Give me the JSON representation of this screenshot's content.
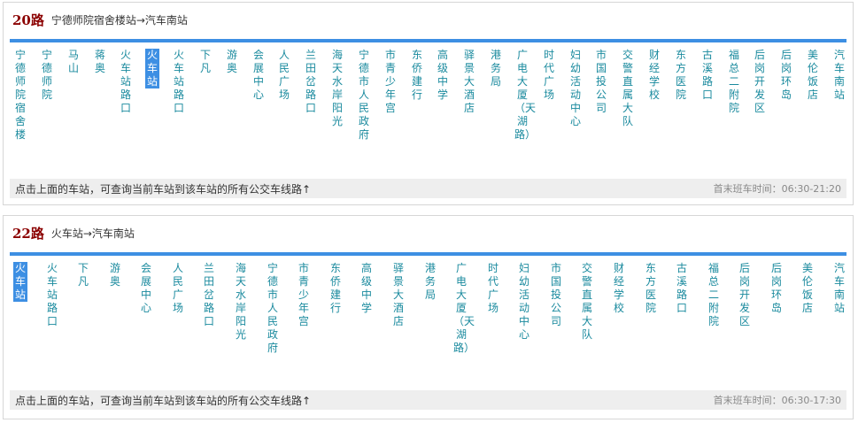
{
  "routes": [
    {
      "number": "20路",
      "direction": "宁德师院宿舍楼站→汽车南站",
      "current_stop_index": 5,
      "stops": [
        "宁德师院宿舍楼",
        "宁德师院",
        "马山",
        "蒋奥",
        "火车站路口",
        "火车站",
        "火车站路口",
        "下凡",
        "游奥",
        "会展中心",
        "人民广场",
        "兰田岔路口",
        "海天水岸阳光",
        "宁德市人民政府",
        "市青少年宫",
        "东侨建行",
        "高级中学",
        "驿景大酒店",
        "港务局",
        "广电大厦（天湖路）",
        "时代广场",
        "妇幼活动中心",
        "市国投公司",
        "交警直属大队",
        "财经学校",
        "东方医院",
        "古溪路口",
        "福总二附院",
        "后岗开发区",
        "后岗环岛",
        "美伦饭店",
        "汽车南站"
      ],
      "hint": "点击上面的车站，可查询当前车站到该车站的所有公交车线路↑",
      "times": "首末班车时间：06:30-21:20"
    },
    {
      "number": "22路",
      "direction": "火车站→汽车南站",
      "current_stop_index": 0,
      "stops": [
        "火车站",
        "火车站路口",
        "下凡",
        "游奥",
        "会展中心",
        "人民广场",
        "兰田岔路口",
        "海天水岸阳光",
        "宁德市人民政府",
        "市青少年宫",
        "东侨建行",
        "高级中学",
        "驿景大酒店",
        "港务局",
        "广电大厦（天湖路）",
        "时代广场",
        "妇幼活动中心",
        "市国投公司",
        "交警直属大队",
        "财经学校",
        "东方医院",
        "古溪路口",
        "福总二附院",
        "后岗开发区",
        "后岗环岛",
        "美伦饭店",
        "汽车南站"
      ],
      "hint": "点击上面的车站，可查询当前车站到该车站的所有公交车线路↑",
      "times": "首末班车时间：06:30-17:30"
    }
  ]
}
